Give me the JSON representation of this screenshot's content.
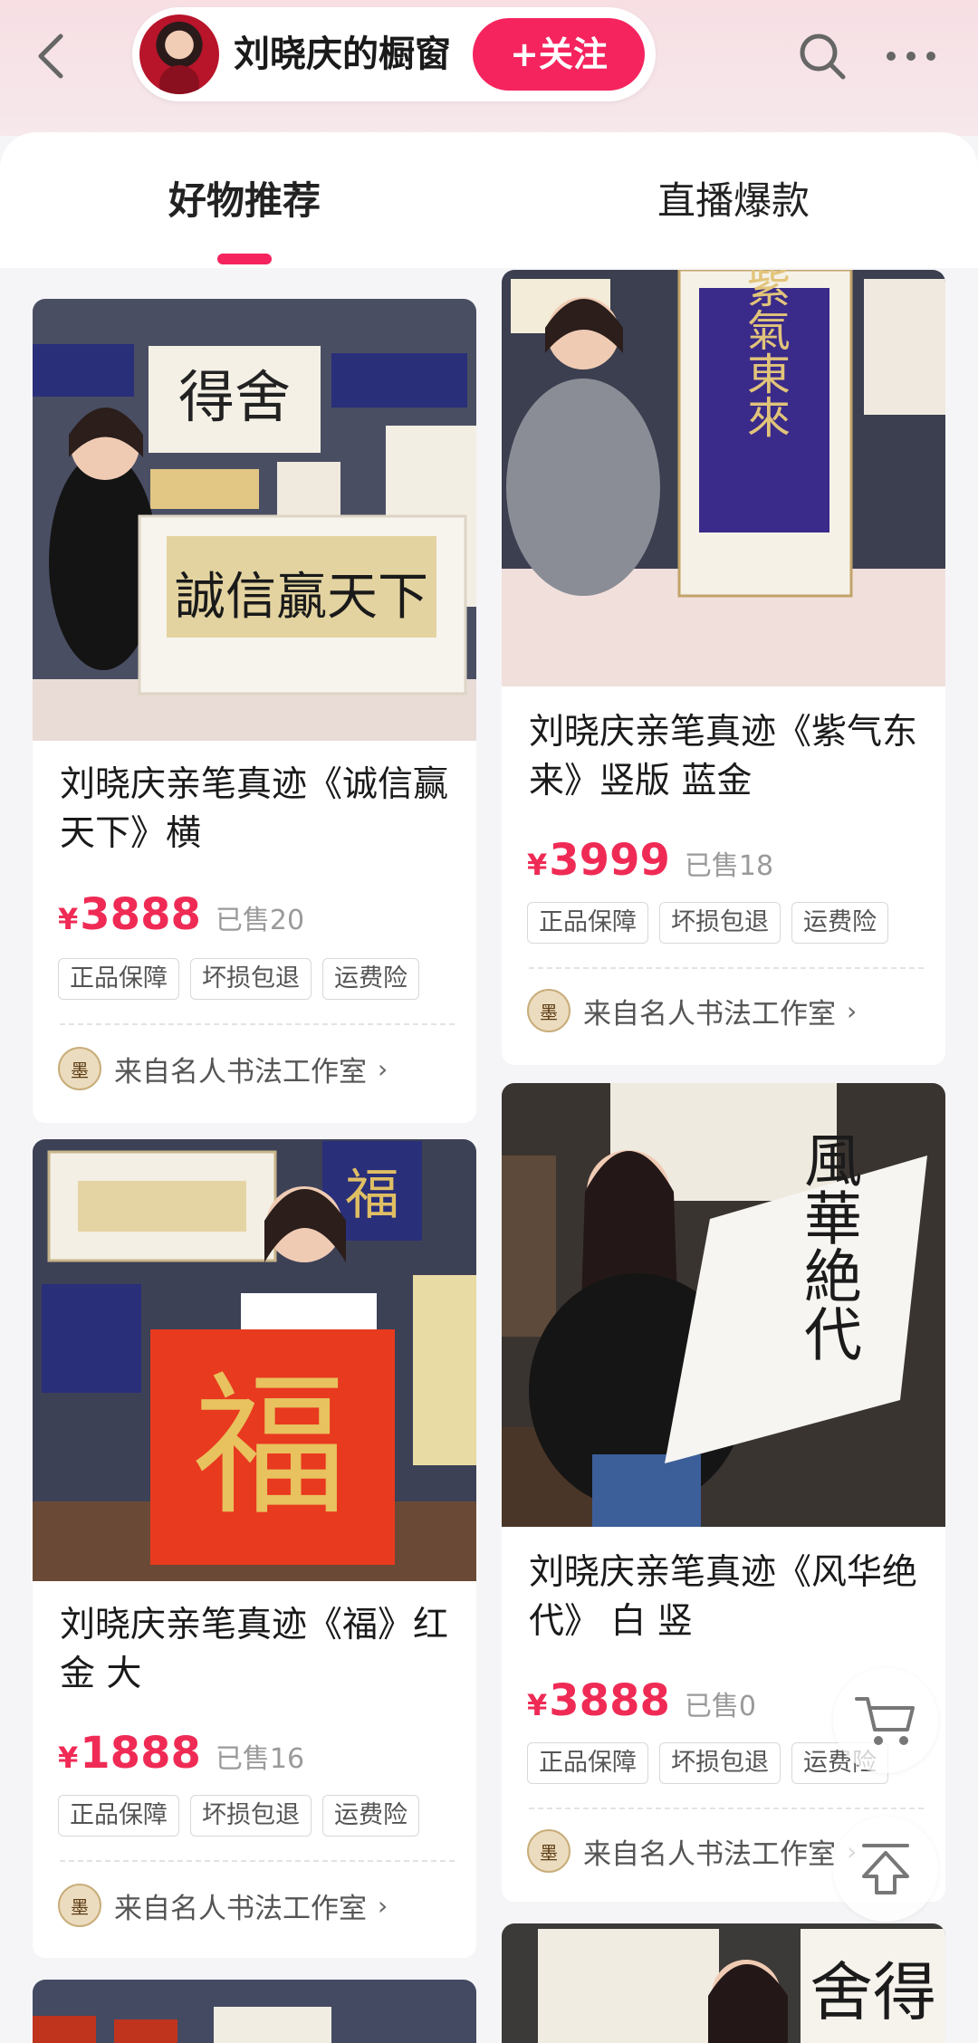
{
  "header": {
    "back_icon": "chevron-left-icon",
    "shop_name": "刘晓庆的橱窗",
    "follow_label": "+关注",
    "search_icon": "search-icon",
    "more_icon": "more-dots-icon",
    "accent": "#f5245e"
  },
  "tabs": [
    {
      "label": "好物推荐",
      "active": true
    },
    {
      "label": "直播爆款",
      "active": false
    }
  ],
  "products": [
    {
      "title": "刘晓庆亲笔真迹《诚信赢天下》横",
      "currency": "¥",
      "price": "3888",
      "sold": "已售20",
      "badges": [
        "正品保障",
        "坏损包退",
        "运费险"
      ],
      "source": "来自名人书法工作室",
      "source_logo_text": "墨"
    },
    {
      "title": "刘晓庆亲笔真迹《紫气东来》竖版  蓝金",
      "currency": "¥",
      "price": "3999",
      "sold": "已售18",
      "badges": [
        "正品保障",
        "坏损包退",
        "运费险"
      ],
      "source": "来自名人书法工作室",
      "source_logo_text": "墨"
    },
    {
      "title": "刘晓庆亲笔真迹《福》红金   大",
      "currency": "¥",
      "price": "1888",
      "sold": "已售16",
      "badges": [
        "正品保障",
        "坏损包退",
        "运费险"
      ],
      "source": "来自名人书法工作室",
      "source_logo_text": "墨"
    },
    {
      "title": "刘晓庆亲笔真迹《风华绝代》 白 竖",
      "currency": "¥",
      "price": "3888",
      "sold": "已售0",
      "badges": [
        "正品保障",
        "坏损包退",
        "运费险"
      ],
      "source": "来自名人书法工作室",
      "source_logo_text": "墨"
    }
  ],
  "artwork": {
    "p1_text": "誠信贏天下",
    "p1_bg_text": "得舍",
    "p2_text": "紫氣東來",
    "p3_text": "福",
    "p3_small_text": "福",
    "p4_text": "風華絶代",
    "p6_text": "舍得"
  },
  "floating": {
    "cart_icon": "shopping-cart-icon",
    "top_icon": "back-to-top-icon"
  }
}
